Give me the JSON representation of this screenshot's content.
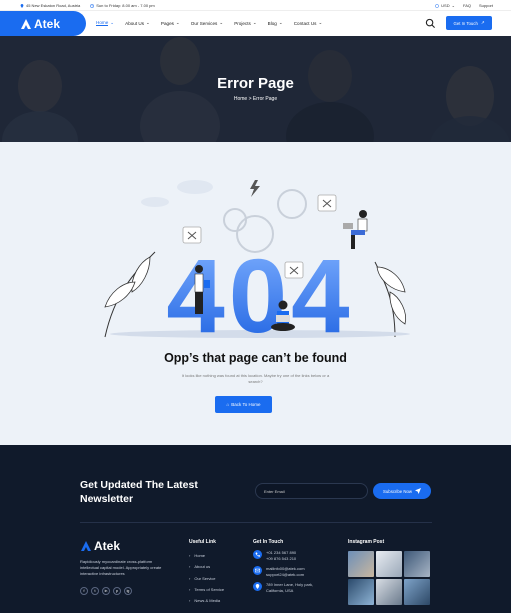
{
  "topbar": {
    "address": "45 New Eskaton Road, Austria",
    "hours": "Sun to Friday: 8.00 am - 7.00 pm",
    "currency": "USD",
    "faq": "FAQ",
    "support": "Support"
  },
  "brand": {
    "name": "Atek"
  },
  "nav": {
    "items": [
      {
        "label": "Home",
        "active": true
      },
      {
        "label": "About Us"
      },
      {
        "label": "Pages"
      },
      {
        "label": "Our Services"
      },
      {
        "label": "Projects"
      },
      {
        "label": "Blog"
      },
      {
        "label": "Contact Us"
      }
    ],
    "cta": "Get In Touch"
  },
  "hero": {
    "title": "Error Page",
    "breadcrumb_home": "Home",
    "breadcrumb_sep": ">",
    "breadcrumb_current": "Error Page"
  },
  "error": {
    "big_text": "404",
    "heading": "Opp’s that page can’t be found",
    "message": "It looks like nothing was found at this location. Maybe try one of the links below or a search?",
    "button": "Back To Home"
  },
  "newsletter": {
    "title": "Get Updated The Latest Newsletter",
    "placeholder": "Enter Email",
    "button": "Subscribe Now"
  },
  "footer": {
    "about": "Rapidiously myocardinate cross-platform intellectual capital model. Appropriately create interactive infrastructures",
    "social": [
      "f",
      "t",
      "in",
      "p",
      "ig"
    ],
    "useful_title": "Useful Link",
    "useful_links": [
      "Home",
      "About us",
      "Our Service",
      "Terms of Service",
      "News & Media"
    ],
    "touch_title": "Get In Touch",
    "touch": {
      "phone1": "+01 234 567 890",
      "phone2": "+09 876 543 210",
      "email1": "mailinfo00@atek.com",
      "email2": "support24@atek.com",
      "addr1": "789 Inner Lane, Holy park,",
      "addr2": "California, USA"
    },
    "insta_title": "Instagram Post"
  },
  "colors": {
    "accent": "#1a6cf0",
    "footer_bg": "#101a2b",
    "section_bg": "#edf2f8"
  }
}
